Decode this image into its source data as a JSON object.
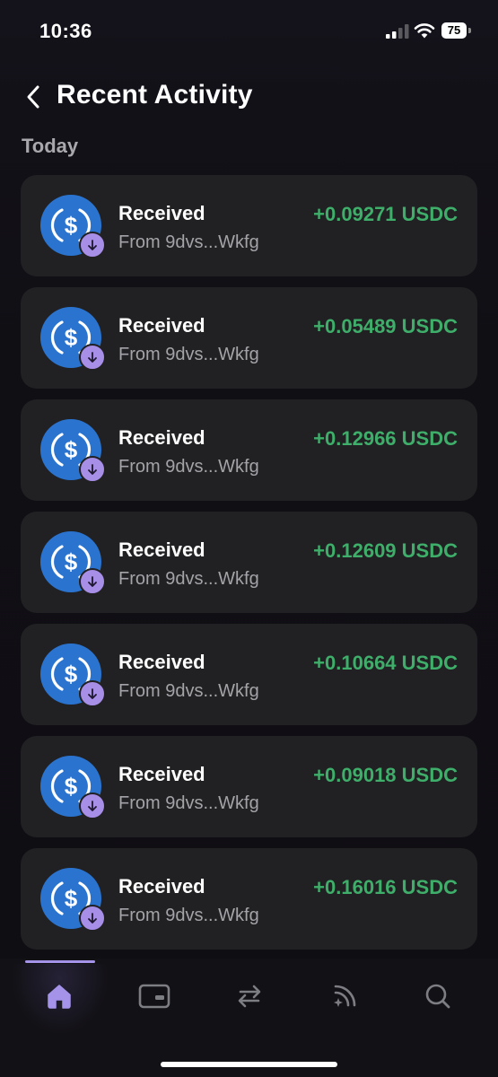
{
  "status_bar": {
    "time": "10:36",
    "battery_level": "75"
  },
  "header": {
    "title": "Recent Activity",
    "back_icon": "chevron-left-icon"
  },
  "section": {
    "label": "Today"
  },
  "colors": {
    "accent": "#a593ea",
    "positive": "#3fae6a",
    "usdc_blue": "#2a74d0",
    "card_bg": "#212123"
  },
  "activities": [
    {
      "type": "Received",
      "from": "From 9dvs...Wkfg",
      "amount": "+0.09271 USDC"
    },
    {
      "type": "Received",
      "from": "From 9dvs...Wkfg",
      "amount": "+0.05489 USDC"
    },
    {
      "type": "Received",
      "from": "From 9dvs...Wkfg",
      "amount": "+0.12966 USDC"
    },
    {
      "type": "Received",
      "from": "From 9dvs...Wkfg",
      "amount": "+0.12609 USDC"
    },
    {
      "type": "Received",
      "from": "From 9dvs...Wkfg",
      "amount": "+0.10664 USDC"
    },
    {
      "type": "Received",
      "from": "From 9dvs...Wkfg",
      "amount": "+0.09018 USDC"
    },
    {
      "type": "Received",
      "from": "From 9dvs...Wkfg",
      "amount": "+0.16016 USDC"
    }
  ],
  "tab_bar": {
    "tabs": [
      {
        "icon": "home-icon",
        "active": true
      },
      {
        "icon": "wallet-card-icon",
        "active": false
      },
      {
        "icon": "swap-icon",
        "active": false
      },
      {
        "icon": "feed-icon",
        "active": false
      },
      {
        "icon": "search-icon",
        "active": false
      }
    ]
  }
}
